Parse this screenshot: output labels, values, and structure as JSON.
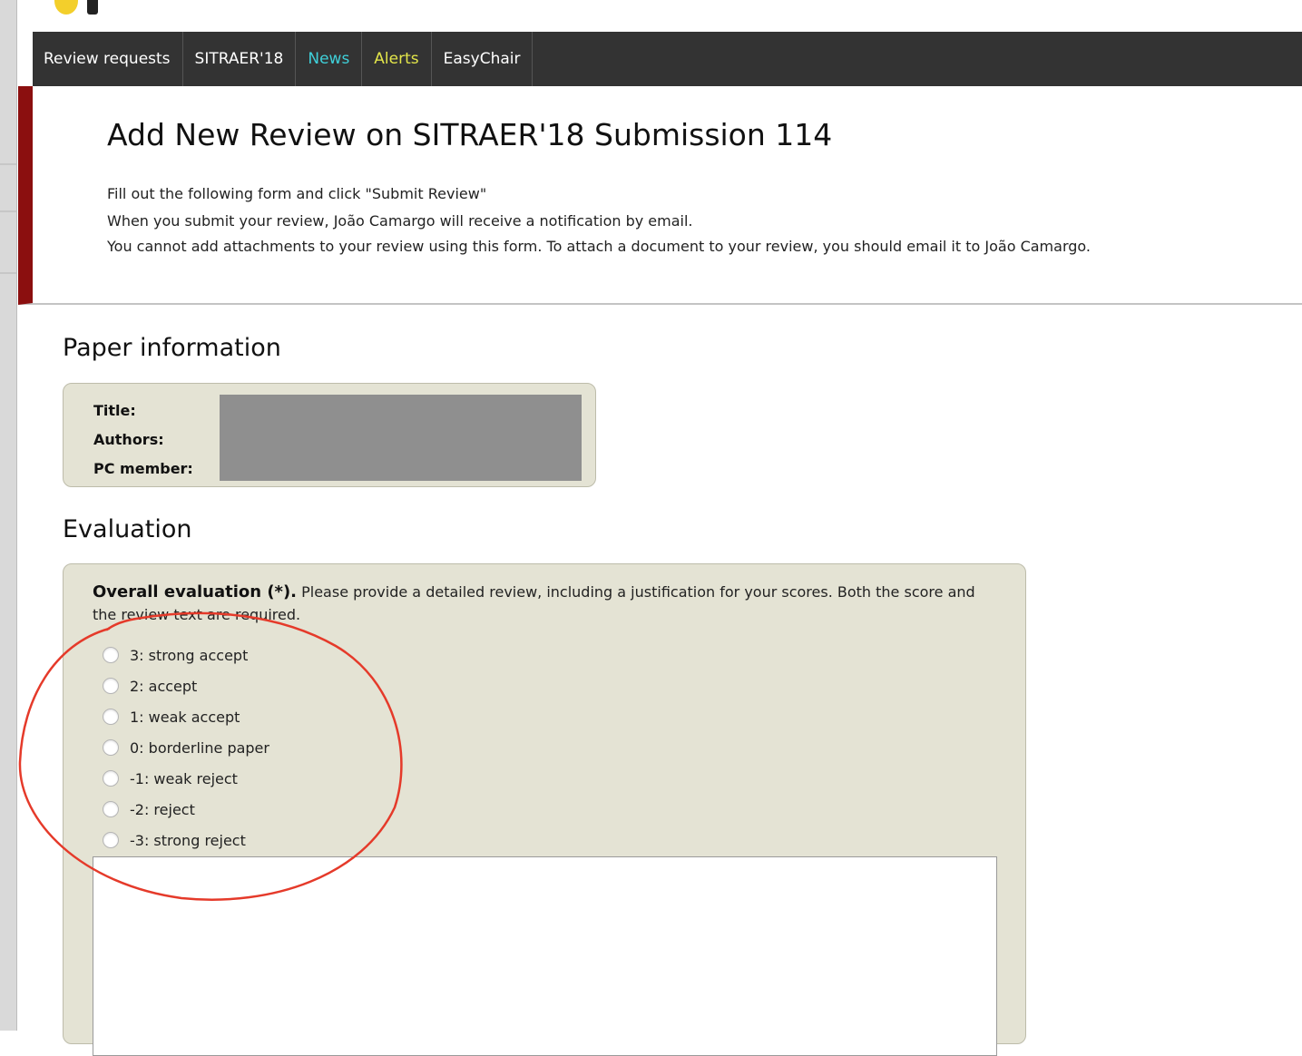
{
  "nav": {
    "items": [
      {
        "label": "Review requests",
        "color": "#ffffff"
      },
      {
        "label": "SITRAER'18",
        "color": "#ffffff"
      },
      {
        "label": "News",
        "color": "#3fd0d9"
      },
      {
        "label": "Alerts",
        "color": "#e3e64a"
      },
      {
        "label": "EasyChair",
        "color": "#ffffff"
      }
    ]
  },
  "header": {
    "title": "Add New Review on SITRAER'18 Submission 114",
    "intro": [
      "Fill out the following form and click \"Submit Review\"",
      "When you submit your review, João Camargo will receive a notification by email.",
      "You cannot add attachments to your review using this form. To attach a document to your review, you should email it to João Camargo."
    ]
  },
  "paper_info": {
    "heading": "Paper information",
    "labels": [
      "Title:",
      "Authors:",
      "PC member:"
    ]
  },
  "evaluation": {
    "heading": "Evaluation",
    "overall_label": "Overall evaluation (*).",
    "overall_desc": " Please provide a detailed review, including a justification for your scores. Both the score and the review text are required.",
    "options": [
      "3: strong accept",
      "2: accept",
      "1: weak accept",
      "0: borderline paper",
      "-1: weak reject",
      "-2: reject",
      "-3: strong reject"
    ]
  },
  "colors": {
    "menubar": "#333333",
    "accent_bar": "#8b0f0f",
    "panel": "#e4e3d4",
    "annotation": "#e53a2a"
  }
}
